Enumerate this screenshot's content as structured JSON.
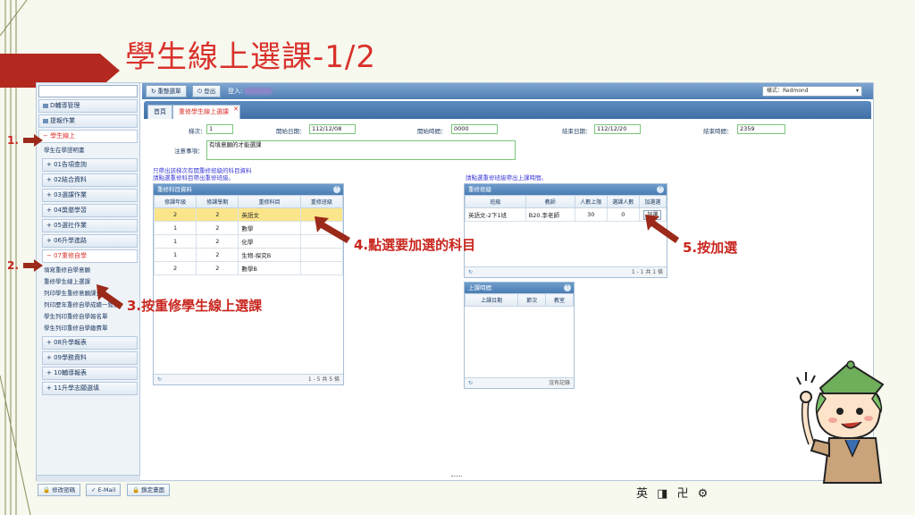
{
  "slide": {
    "title": "學生線上選課-1/2",
    "annotations": {
      "step1": "1.",
      "step2": "2.",
      "step3": "3.按重修學生線上選課",
      "step4": "4.點選要加選的科目",
      "step5": "5.按加選"
    }
  },
  "sidebar": {
    "top_items": [
      "D輔導管理",
      "提報作業"
    ],
    "active_item": "學生線上",
    "link_item": "學生在學證明書",
    "sub_items_a": [
      "01告項查詢",
      "02結合資料",
      "03選課作業",
      "04獎懲學習",
      "05選社作業",
      "06升學進路"
    ],
    "active_sub": "07重修自學",
    "repair_links": [
      "填寫重修自學意願",
      "重修學生線上選課",
      "列印學生重修意願課查",
      "列印歷年重修自學成績一覽表",
      "學生列印重修自學報名單",
      "學生列印重修自學繳費單"
    ],
    "sub_items_b": [
      "08升學報表",
      "09學務資料",
      "10輔導報表",
      "11升學志願選填"
    ]
  },
  "topbar": {
    "menu_btn": "重整選單",
    "logout_btn": "登出",
    "login_label": "登入:",
    "theme": "樣式：Redmond"
  },
  "tabs": {
    "home": "首頁",
    "active": "重修學生線上選課",
    "close": "✕"
  },
  "form": {
    "term_label": "梯次：",
    "term_value": "1",
    "start_date_label": "開始日期：",
    "start_date_value": "112/12/08",
    "start_time_label": "開始時間：",
    "start_time_value": "0000",
    "end_date_label": "結束日期：",
    "end_date_value": "112/12/20",
    "end_time_label": "結束時間：",
    "end_time_value": "2359",
    "notes_label": "注意事項：",
    "notes_value": "有填意願的才能選課"
  },
  "notices": {
    "left_1": "只帶出該梯次有開重修班級的科目資料",
    "left_2": "請點選重修科目帶出重修班級。",
    "right_1": "請點選重修班級帶出上課時間。"
  },
  "subjects_grid": {
    "title": "重修科目資料",
    "headers": [
      "修課年級",
      "修課學期",
      "重修科目",
      "重修班級"
    ],
    "rows": [
      [
        "2",
        "2",
        "英語文",
        ""
      ],
      [
        "1",
        "2",
        "數學",
        ""
      ],
      [
        "1",
        "2",
        "化學",
        ""
      ],
      [
        "1",
        "2",
        "生物-探究B",
        ""
      ],
      [
        "2",
        "2",
        "數學B",
        ""
      ]
    ],
    "footer": "1 - 5 共 5 條",
    "refresh": "↻"
  },
  "classes_grid": {
    "title": "重修班級",
    "headers": [
      "班級",
      "教師",
      "人數上限",
      "選課人數",
      "加選選"
    ],
    "rows": [
      [
        "英語文-2下1班",
        "B20.李老師",
        "30",
        "0"
      ]
    ],
    "add_btn": "加選",
    "footer": "1 - 1 共 1 條"
  },
  "schedule_grid": {
    "title": "上課時間",
    "headers": [
      "上課日期",
      "節次",
      "教室"
    ],
    "footer": "沒有記錄"
  },
  "footer": {
    "change_pw": "修改密碼",
    "email": "E-Mail",
    "lock": "鎖定畫面"
  },
  "ime": "英 ◨ 卍 ⚙"
}
